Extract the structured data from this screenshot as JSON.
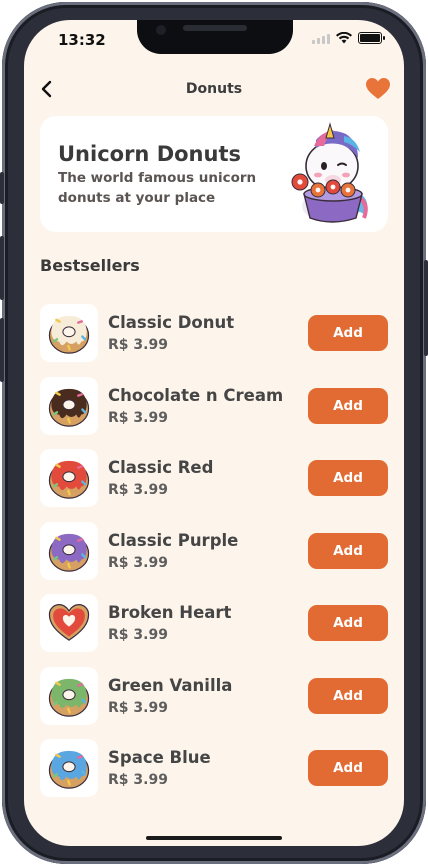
{
  "status_bar": {
    "time": "13:32",
    "battery_level": 1.0
  },
  "nav": {
    "title": "Donuts",
    "back_icon": "chevron-left-icon",
    "favorite_icon": "heart-icon",
    "accent": "#e8743a"
  },
  "hero": {
    "title": "Unicorn Donuts",
    "subtitle": "The world famous unicorn donuts at your place",
    "art": "unicorn-eating-donuts-illustration"
  },
  "section": {
    "title": "Bestsellers"
  },
  "colors": {
    "background": "#fdf5ec",
    "card": "#ffffff",
    "button": "#e26b33",
    "button_text": "#ffffff"
  },
  "products": [
    {
      "name": "Classic Donut",
      "price": "R$ 3.99",
      "button": "Add",
      "icing": "#f6ecd8",
      "sprinkles": true
    },
    {
      "name": "Chocolate n Cream",
      "price": "R$ 3.99",
      "button": "Add",
      "icing": "#4a2c1e",
      "sprinkles": true
    },
    {
      "name": "Classic Red",
      "price": "R$ 3.99",
      "button": "Add",
      "icing": "#e24b3c",
      "sprinkles": true
    },
    {
      "name": "Classic Purple",
      "price": "R$ 3.99",
      "button": "Add",
      "icing": "#8c6ac4",
      "sprinkles": true
    },
    {
      "name": "Broken Heart",
      "price": "R$ 3.99",
      "button": "Add",
      "icing": "#e24b3c",
      "sprinkles": false
    },
    {
      "name": "Green Vanilla",
      "price": "R$ 3.99",
      "button": "Add",
      "icing": "#7bb66a",
      "sprinkles": true
    },
    {
      "name": "Space Blue",
      "price": "R$ 3.99",
      "button": "Add",
      "icing": "#5aa6e0",
      "sprinkles": true
    }
  ]
}
